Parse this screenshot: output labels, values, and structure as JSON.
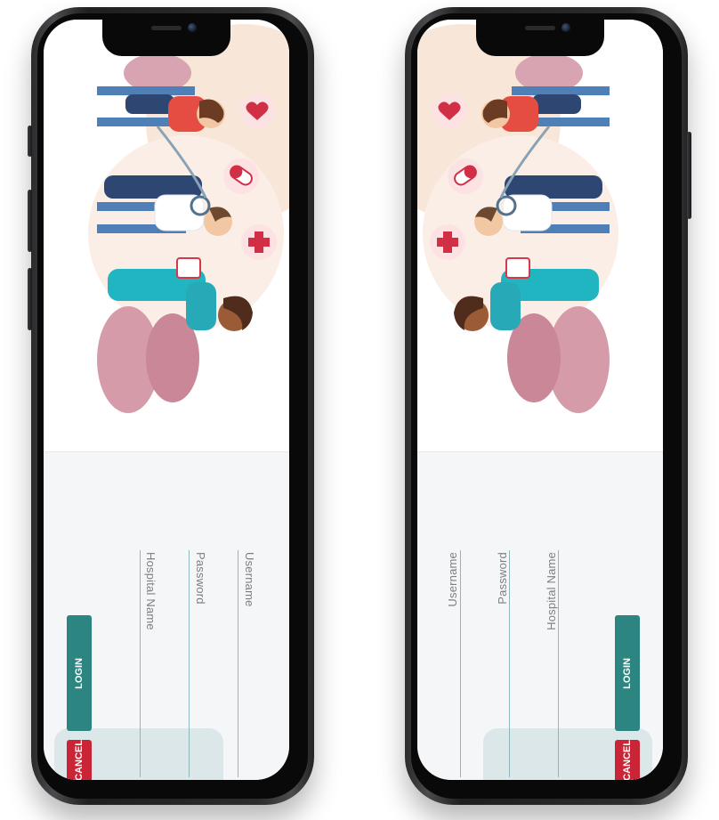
{
  "screen": {
    "username_label": "Username",
    "password_label": "Password",
    "hospital_label": "Hospital Name",
    "login_label": "LOGIN",
    "cancel_label": "CANCEL"
  },
  "icons": {
    "heart": "heart-icon",
    "pill": "pill-icon",
    "cross": "medical-cross-icon"
  },
  "colors": {
    "primary": "#2d8582",
    "danger": "#c92537",
    "background": "#f6f6f7"
  }
}
